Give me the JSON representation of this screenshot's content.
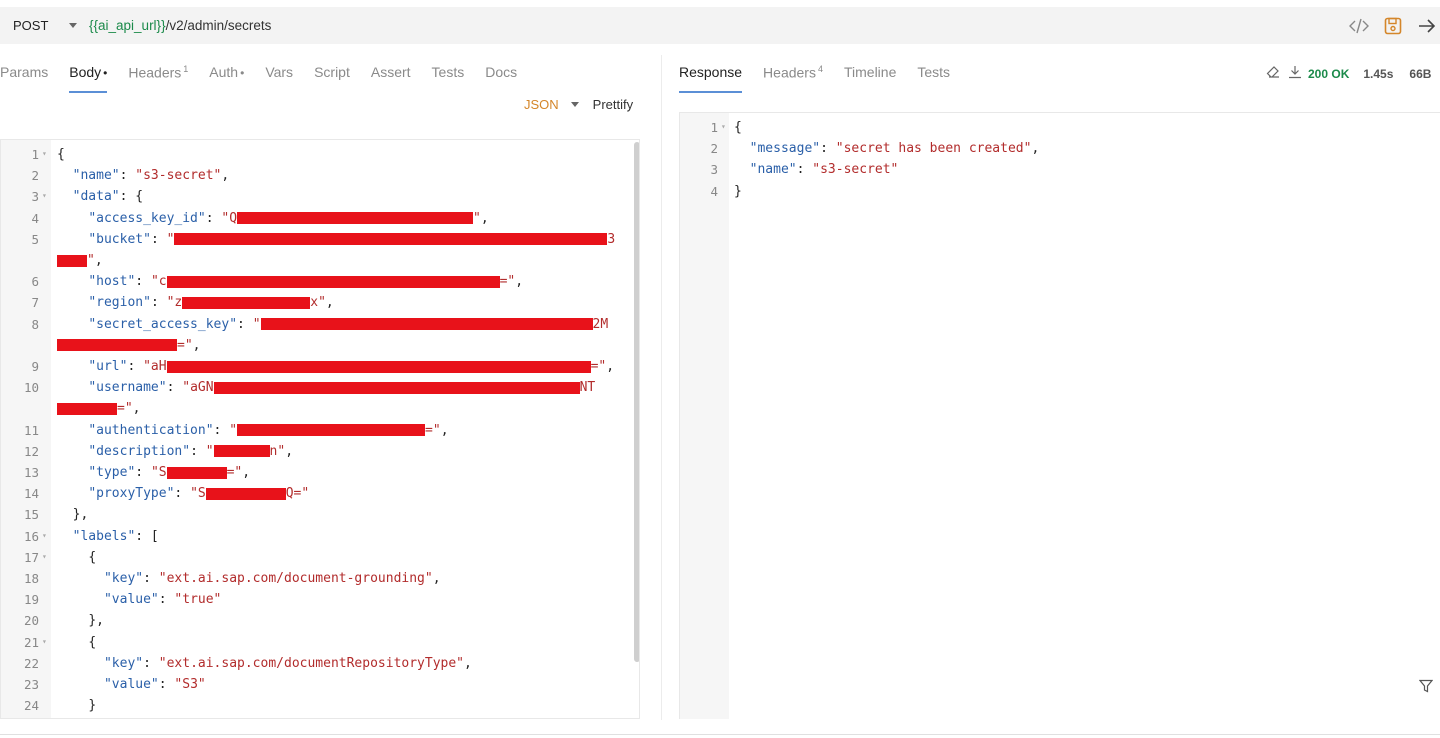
{
  "request": {
    "method": "POST",
    "url_var": "{{ai_api_url}}",
    "url_path": "/v2/admin/secrets",
    "tabs": [
      {
        "label": "Params"
      },
      {
        "label": "Body",
        "dot": "•"
      },
      {
        "label": "Headers",
        "sup": "1"
      },
      {
        "label": "Auth",
        "dot": "•"
      },
      {
        "label": "Vars"
      },
      {
        "label": "Script"
      },
      {
        "label": "Assert"
      },
      {
        "label": "Tests"
      },
      {
        "label": "Docs"
      }
    ],
    "body_mode": "JSON",
    "prettify": "Prettify",
    "line_numbers": [
      "1",
      "2",
      "3",
      "4",
      "5",
      "",
      "6",
      "7",
      "8",
      "",
      "9",
      "10",
      "",
      "11",
      "12",
      "13",
      "14",
      "15",
      "16",
      "17",
      "18",
      "19",
      "20",
      "21",
      "22",
      "23",
      "24"
    ],
    "code": {
      "l1": "{",
      "l2_key": "\"name\"",
      "l2_val": "\"s3-secret\"",
      "l3_key": "\"data\"",
      "l4_key": "\"access_key_id\"",
      "l4_val_a": "\"Q",
      "l4_val_b": "\"",
      "l5_key": "\"bucket\"",
      "l5_val_a": "\"",
      "l5_val_b": "3",
      "l5b_val": "\"",
      "l6_key": "\"host\"",
      "l6_val_a": "\"c",
      "l6_val_b": "=\"",
      "l7_key": "\"region\"",
      "l7_val_a": "\"z",
      "l7_val_b": "x\"",
      "l8_key": "\"secret_access_key\"",
      "l8_val_a": "\"",
      "l8_val_b": "2M",
      "l8b_val": "=\"",
      "l9_key": "\"url\"",
      "l9_val_a": "\"aH",
      "l9_val_b": "=\"",
      "l10_key": "\"username\"",
      "l10_val_a": "\"aGN",
      "l10_val_b": "NT",
      "l10b_val": "=\"",
      "l11_key": "\"authentication\"",
      "l11_val_a": "\"",
      "l11_val_b": "=\"",
      "l12_key": "\"description\"",
      "l12_val_a": "\"",
      "l12_val_b": "n\"",
      "l13_key": "\"type\"",
      "l13_val_a": "\"S",
      "l13_val_b": "=\"",
      "l14_key": "\"proxyType\"",
      "l14_val_a": "\"S",
      "l14_val_b": "Q=\"",
      "l15": "},",
      "l16_key": "\"labels\"",
      "l17": "{",
      "l18_key": "\"key\"",
      "l18_val": "\"ext.ai.sap.com/document-grounding\"",
      "l19_key": "\"value\"",
      "l19_val": "\"true\"",
      "l20": "},",
      "l21": "{",
      "l22_key": "\"key\"",
      "l22_val": "\"ext.ai.sap.com/documentRepositoryType\"",
      "l23_key": "\"value\"",
      "l23_val": "\"S3\"",
      "l24": "}"
    }
  },
  "response": {
    "tabs": [
      {
        "label": "Response"
      },
      {
        "label": "Headers",
        "sup": "4"
      },
      {
        "label": "Timeline"
      },
      {
        "label": "Tests"
      }
    ],
    "status": "200 OK",
    "time": "1.45s",
    "size": "66B",
    "line_numbers": [
      "1",
      "2",
      "3",
      "4"
    ],
    "code": {
      "l1": "{",
      "l2_key": "\"message\"",
      "l2_val": "\"secret has been created\"",
      "l3_key": "\"name\"",
      "l3_val": "\"s3-secret\"",
      "l4": "}"
    }
  },
  "colors": {
    "accent": "#5b8fd6",
    "status_ok": "#1b8a4a",
    "json_mode": "#d4862a",
    "redaction": "#e8121a"
  },
  "icons": [
    "chevron-down-icon",
    "code-icon",
    "save-icon",
    "arrow-right-icon",
    "eraser-icon",
    "download-icon",
    "filter-icon"
  ]
}
